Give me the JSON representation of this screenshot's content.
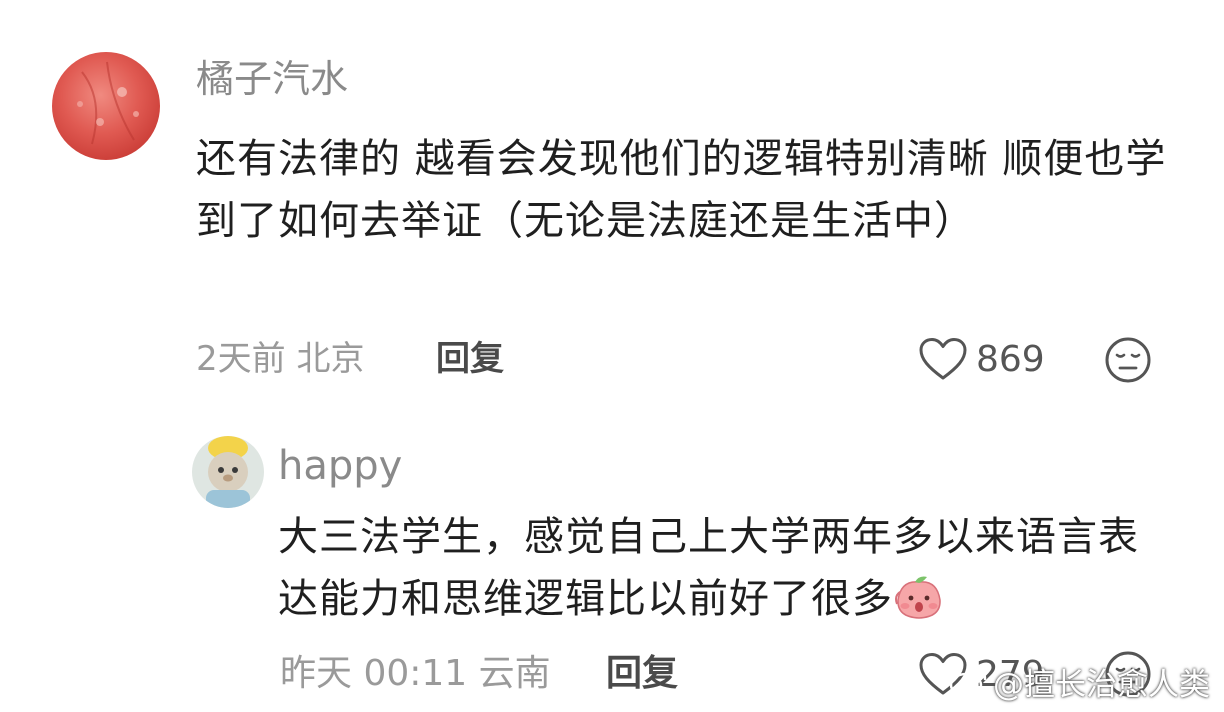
{
  "comments": [
    {
      "username": "橘子汽水",
      "text": "还有法律的 越看会发现他们的逻辑特别清晰 顺便也学到了如何去举证（无论是法庭还是生活中）",
      "time": "2天前",
      "location": "北京",
      "reply_label": "回复",
      "like_count": "869",
      "avatar_icon": "orange-avatar-icon",
      "like_icon": "heart-outline-icon",
      "dislike_icon": "meh-face-icon"
    },
    {
      "username": "happy",
      "text": "大三法学生，感觉自己上大学两年多以来语言表达能力和思维逻辑比以前好了很多",
      "emoji": "shy-peach-emoji",
      "time": "昨天 00:11",
      "location": "云南",
      "reply_label": "回复",
      "like_count": "279",
      "avatar_icon": "plush-toy-avatar-icon",
      "like_icon": "heart-outline-icon",
      "dislike_icon": "meh-face-icon"
    }
  ],
  "watermark": {
    "text": "@擅长治愈人类",
    "icon": "weibo-logo-icon"
  },
  "colors": {
    "username": "#8a8a8a",
    "text": "#1f1f1f",
    "meta": "#9a9a9a",
    "reply": "#4a4a4a"
  }
}
